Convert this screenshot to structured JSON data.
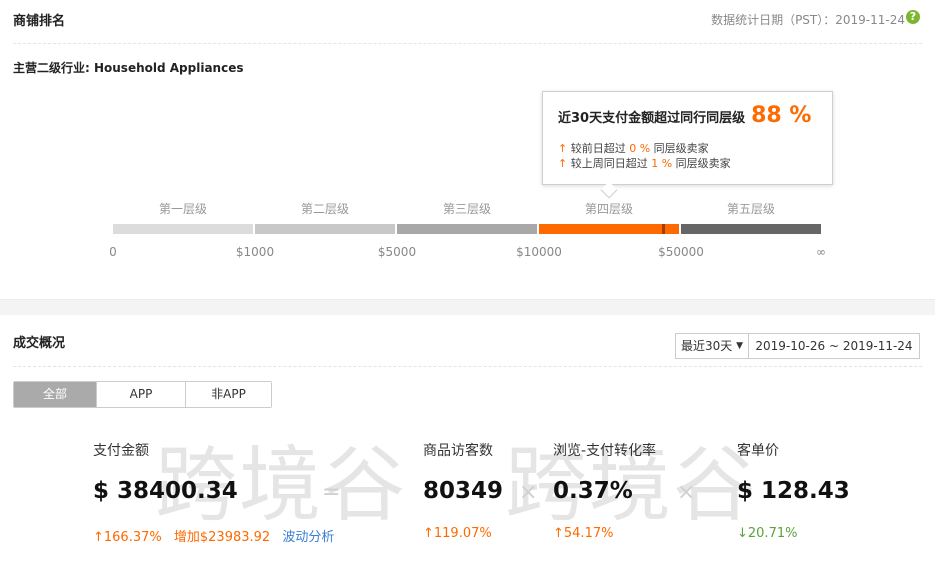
{
  "ranking": {
    "title": "商铺排名",
    "stat_date": "数据统计日期（PST）：2019-11-24",
    "help_icon": "?",
    "industry": "主营二级行业: Household Appliances",
    "tooltip": {
      "headline": "近30天支付金额超过同行同层级",
      "percent": "88 %",
      "line1_prefix": "较前日超过",
      "line1_value": "0 %",
      "line1_suffix": "同层级卖家",
      "line2_prefix": "较上周同日超过",
      "line2_value": "1 %",
      "line2_suffix": "同层级卖家",
      "arrow_glyph": "↑"
    },
    "tiers": [
      {
        "label": "第一层级",
        "color": "#dcdcdc"
      },
      {
        "label": "第二层级",
        "color": "#c8c8c8"
      },
      {
        "label": "第三层级",
        "color": "#a8a8a8"
      },
      {
        "label": "第四层级",
        "color": "#ff6a00"
      },
      {
        "label": "第五层级",
        "color": "#666666"
      }
    ],
    "ticks": [
      "0",
      "$1000",
      "$5000",
      "$10000",
      "$50000",
      "∞"
    ]
  },
  "overview": {
    "title": "成交概况",
    "range_select": "最近30天",
    "date_range": "2019-10-26 ~ 2019-11-24",
    "tabs": [
      "全部",
      "APP",
      "非APP"
    ],
    "active_tab": 0,
    "metrics": {
      "payment": {
        "label": "支付金额",
        "value": "$ 38400.34",
        "change": "↑166.37%",
        "increase": "增加$23983.92",
        "link": "波动分析"
      },
      "visitors": {
        "label": "商品访客数",
        "value": "80349",
        "change": "↑119.07%"
      },
      "conversion": {
        "label": "浏览-支付转化率",
        "value": "0.37%",
        "change": "↑54.17%"
      },
      "aov": {
        "label": "客单价",
        "value": "$ 128.43",
        "change": "↓20.71%"
      }
    },
    "operators": {
      "equals": "=",
      "times": "×"
    },
    "watermark": [
      "跨境谷",
      "跨境谷"
    ]
  }
}
